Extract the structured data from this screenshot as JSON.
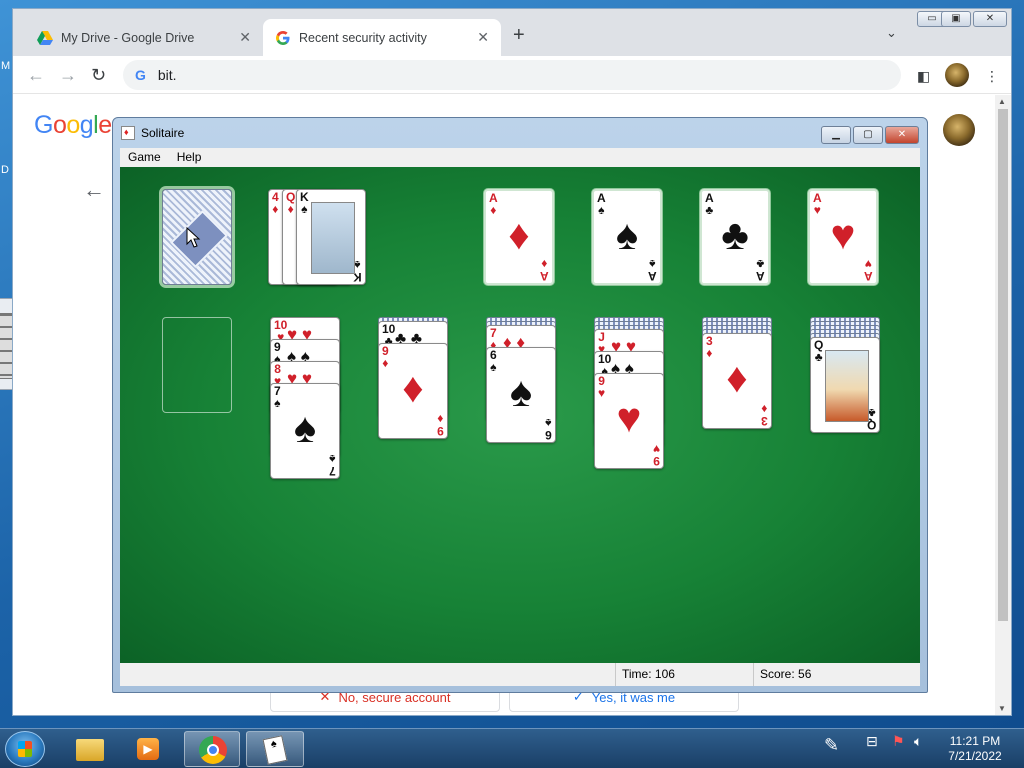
{
  "desktop": {
    "edge_letters": [
      "M",
      "D"
    ]
  },
  "browser": {
    "tabs": [
      {
        "title": "My Drive - Google Drive",
        "icon": "google-drive-icon",
        "active": false
      },
      {
        "title": "Recent security activity",
        "icon": "google-g-icon",
        "active": true
      }
    ],
    "omnibox": {
      "text": "bit."
    },
    "page": {
      "logo": "Google",
      "buttons": [
        "No, secure account",
        "Yes, it was me"
      ]
    }
  },
  "solitaire": {
    "title": "Solitaire",
    "menu": [
      "Game",
      "Help"
    ],
    "status": {
      "time_label": "Time:",
      "time": "106",
      "score_label": "Score:",
      "score": "56"
    },
    "waste": [
      {
        "rank": "4",
        "suit": "♦",
        "color": "red"
      },
      {
        "rank": "Q",
        "suit": "♦",
        "color": "red"
      },
      {
        "rank": "K",
        "suit": "♠",
        "color": "black"
      }
    ],
    "foundations": [
      {
        "rank": "A",
        "suit": "♦",
        "color": "red"
      },
      {
        "rank": "A",
        "suit": "♠",
        "color": "black"
      },
      {
        "rank": "A",
        "suit": "♣",
        "color": "black"
      },
      {
        "rank": "A",
        "suit": "♥",
        "color": "red"
      }
    ],
    "tableau": [
      {
        "hidden": 0,
        "cards": []
      },
      {
        "hidden": 0,
        "cards": [
          {
            "rank": "10",
            "suit": "♥",
            "color": "red"
          },
          {
            "rank": "9",
            "suit": "♠",
            "color": "black"
          },
          {
            "rank": "8",
            "suit": "♥",
            "color": "red"
          },
          {
            "rank": "7",
            "suit": "♠",
            "color": "black"
          }
        ]
      },
      {
        "hidden": 1,
        "cards": [
          {
            "rank": "10",
            "suit": "♣",
            "color": "black"
          },
          {
            "rank": "9",
            "suit": "♦",
            "color": "red"
          }
        ]
      },
      {
        "hidden": 2,
        "cards": [
          {
            "rank": "7",
            "suit": "♦",
            "color": "red"
          },
          {
            "rank": "6",
            "suit": "♠",
            "color": "black"
          }
        ]
      },
      {
        "hidden": 3,
        "cards": [
          {
            "rank": "J",
            "suit": "♥",
            "color": "red"
          },
          {
            "rank": "10",
            "suit": "♠",
            "color": "black"
          },
          {
            "rank": "9",
            "suit": "♥",
            "color": "red"
          }
        ]
      },
      {
        "hidden": 4,
        "cards": [
          {
            "rank": "3",
            "suit": "♦",
            "color": "red"
          }
        ]
      },
      {
        "hidden": 5,
        "cards": [
          {
            "rank": "Q",
            "suit": "♣",
            "color": "black"
          }
        ]
      }
    ]
  },
  "taskbar": {
    "apps": [
      "windows-explorer-icon",
      "media-player-icon",
      "chrome-icon",
      "solitaire-icon"
    ],
    "time": "11:21 PM",
    "date": "7/21/2022"
  }
}
